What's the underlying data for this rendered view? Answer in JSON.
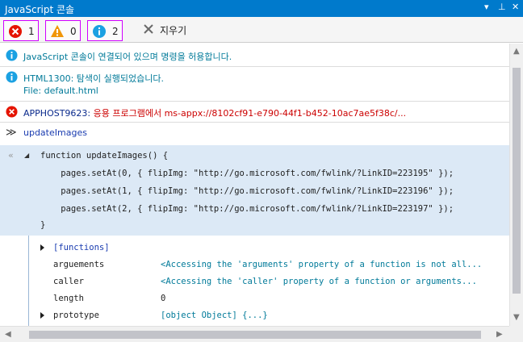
{
  "window": {
    "title": "JavaScript 콘솔",
    "dropdown_glyph": "▾",
    "pin_glyph": "⊥",
    "close_glyph": "✕"
  },
  "toolbar": {
    "errors_count": "1",
    "warnings_count": "0",
    "messages_count": "2",
    "clear_label": "지우기",
    "filter_border_color": "#d000ff"
  },
  "messages": [
    {
      "type": "info",
      "text": "JavaScript 콘솔이 연결되어 있으며 명령을 허용합니다."
    },
    {
      "type": "info",
      "text": "HTML1300: 탐색이 실행되었습니다.",
      "file": "File: default.html"
    },
    {
      "type": "error",
      "code": "APPHOST9623:",
      "text": "응용 프로그램에서 ms-appx://8102cf91-e790-44f1-b452-10ac7ae5f38c/..."
    }
  ],
  "command": {
    "prompt_glyph": "≫",
    "text": "updateImages"
  },
  "code_block": {
    "back_glyph": "«",
    "expand_glyph": "◢",
    "lines": [
      "function updateImages() {",
      "    pages.setAt(0, { flipImg: \"http://go.microsoft.com/fwlink/?LinkID=223195\" });",
      "    pages.setAt(1, { flipImg: \"http://go.microsoft.com/fwlink/?LinkID=223196\" });",
      "    pages.setAt(2, { flipImg: \"http://go.microsoft.com/fwlink/?LinkID=223197\" });",
      "}"
    ]
  },
  "properties": [
    {
      "name": "[functions]",
      "value": "",
      "expandable": true
    },
    {
      "name": "arguements",
      "value": "<Accessing the 'arguments' property of a function is not all...",
      "expandable": false
    },
    {
      "name": "caller",
      "value": "<Accessing the 'caller' property of a function or arguments...",
      "expandable": false
    },
    {
      "name": "length",
      "value": "0",
      "expandable": false
    },
    {
      "name": "prototype",
      "value": "[object Object] {...}",
      "expandable": true
    }
  ],
  "colors": {
    "titlebar": "#007acc",
    "info_icon": "#1ba1e2",
    "error_icon": "#e51400",
    "warning_icon": "#f09609",
    "code_bg": "#dce9f6",
    "teal_text": "#007a99",
    "red_text": "#cc0000"
  }
}
